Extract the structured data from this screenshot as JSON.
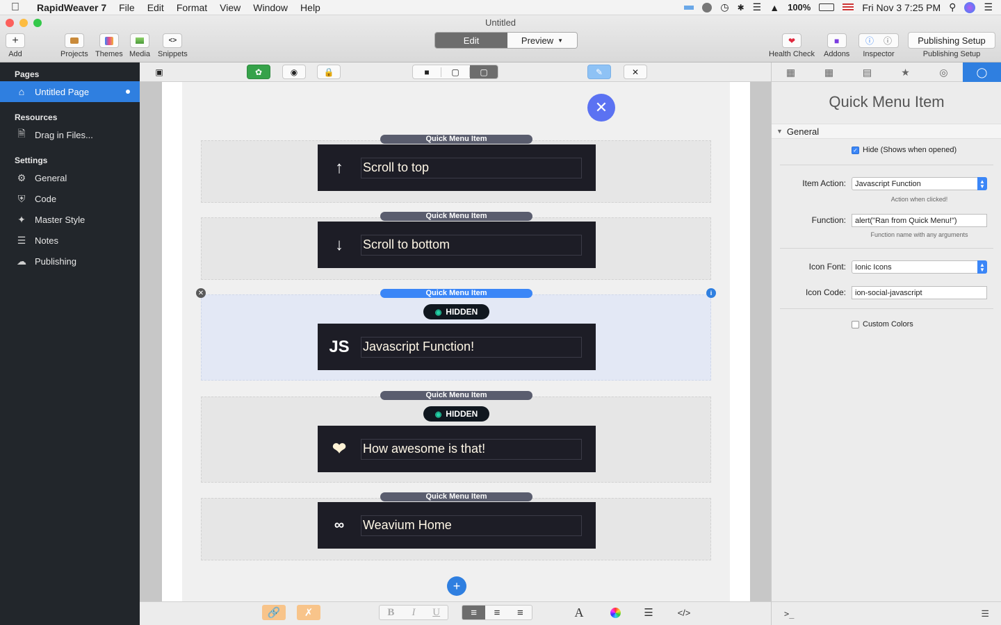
{
  "menubar": {
    "app_name": "RapidWeaver 7",
    "items": [
      "File",
      "Edit",
      "Format",
      "View",
      "Window",
      "Help"
    ],
    "battery": "100%",
    "datetime": "Fri Nov 3  7:25 PM"
  },
  "window": {
    "title": "Untitled"
  },
  "toolbar": {
    "add": "Add",
    "projects": "Projects",
    "themes": "Themes",
    "media": "Media",
    "snippets": "Snippets",
    "edit": "Edit",
    "preview": "Preview",
    "health_check": "Health Check",
    "addons": "Addons",
    "inspector": "Inspector",
    "publishing_setup": "Publishing Setup",
    "publishing_setup_label": "Publishing Setup"
  },
  "sidebar": {
    "pages_heading": "Pages",
    "page": "Untitled Page",
    "resources_heading": "Resources",
    "resources_item": "Drag in Files...",
    "settings_heading": "Settings",
    "settings": [
      "General",
      "Code",
      "Master Style",
      "Notes",
      "Publishing"
    ]
  },
  "canvas": {
    "tag": "Quick Menu Item",
    "hidden": "HIDDEN",
    "items": [
      {
        "label": "Scroll to top",
        "icon": "arrow-up-icon",
        "hidden": false,
        "selected": false
      },
      {
        "label": "Scroll to bottom",
        "icon": "arrow-down-icon",
        "hidden": false,
        "selected": false
      },
      {
        "label": "Javascript Function!",
        "icon": "js-icon",
        "icon_text": "JS",
        "hidden": true,
        "selected": true
      },
      {
        "label": "How awesome is that!",
        "icon": "heart-icon",
        "hidden": true,
        "selected": false
      },
      {
        "label": "Weavium Home",
        "icon": "link-icon",
        "hidden": false,
        "selected": false
      }
    ]
  },
  "inspector": {
    "title": "Quick Menu Item",
    "section": "General",
    "hide_label": "Hide (Shows when opened)",
    "hide_checked": true,
    "item_action_label": "Item Action:",
    "item_action_value": "Javascript Function",
    "item_action_hint": "Action when clicked!",
    "function_label": "Function:",
    "function_value": "alert(\"Ran from Quick Menu!\")",
    "function_hint": "Function name with any arguments",
    "icon_font_label": "Icon Font:",
    "icon_font_value": "Ionic Icons",
    "icon_code_label": "Icon Code:",
    "icon_code_value": "ion-social-javascript",
    "custom_colors_label": "Custom Colors",
    "custom_colors_checked": false,
    "console_prompt": ">_"
  },
  "colors": {
    "accent": "#2f7fe0",
    "fab": "#5b72f2",
    "card": "#1d1d26",
    "tag": "#5a5d6e"
  }
}
